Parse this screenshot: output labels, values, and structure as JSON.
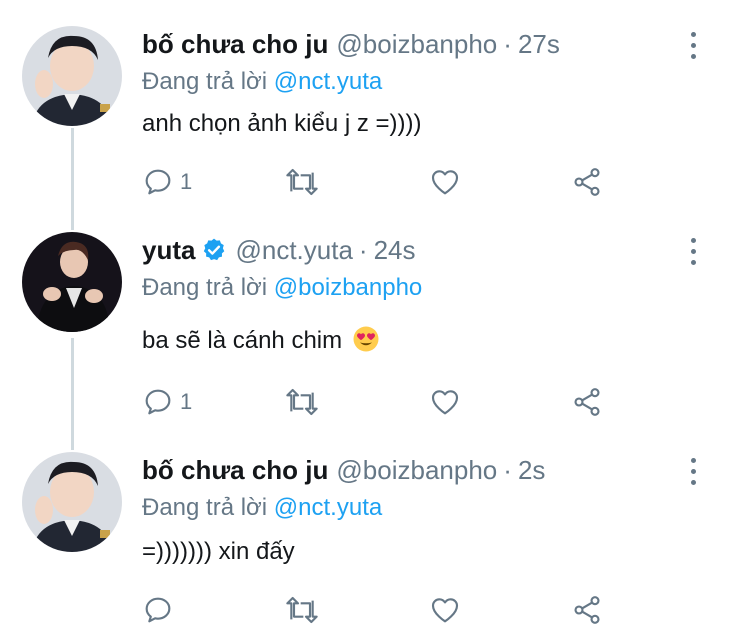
{
  "tweets": [
    {
      "name": "bố chưa cho ju",
      "handle": "@boizbanpho",
      "separator": "·",
      "time": "27s",
      "reply_prefix": "Đang trả lời ",
      "reply_to": "@nct.yuta",
      "text": "anh chọn ảnh kiểu j z =))))",
      "reply_count": "1",
      "verified": false,
      "avatar_icon": "avatar-boy-waving"
    },
    {
      "name": "yuta",
      "handle": "@nct.yuta",
      "separator": "·",
      "time": "24s",
      "reply_prefix": "Đang trả lời ",
      "reply_to": "@boizbanpho",
      "text": "ba sẽ là cánh chim",
      "emoji": "heart-eyes-emoji",
      "reply_count": "1",
      "verified": true,
      "avatar_icon": "avatar-performer-dark"
    },
    {
      "name": "bố chưa cho ju",
      "handle": "@boizbanpho",
      "separator": "·",
      "time": "2s",
      "reply_prefix": "Đang trả lời ",
      "reply_to": "@nct.yuta",
      "text": "=))))))) xin đấy",
      "reply_count": "",
      "verified": false,
      "avatar_icon": "avatar-boy-waving"
    }
  ],
  "colors": {
    "link": "#1da1f2",
    "secondary": "#657786",
    "text": "#14171a",
    "thread_line": "#cfd9de",
    "verified": "#1da1f2"
  },
  "icons": [
    "reply-icon",
    "retweet-icon",
    "like-icon",
    "share-icon",
    "more-options-icon",
    "verified-badge-icon"
  ]
}
